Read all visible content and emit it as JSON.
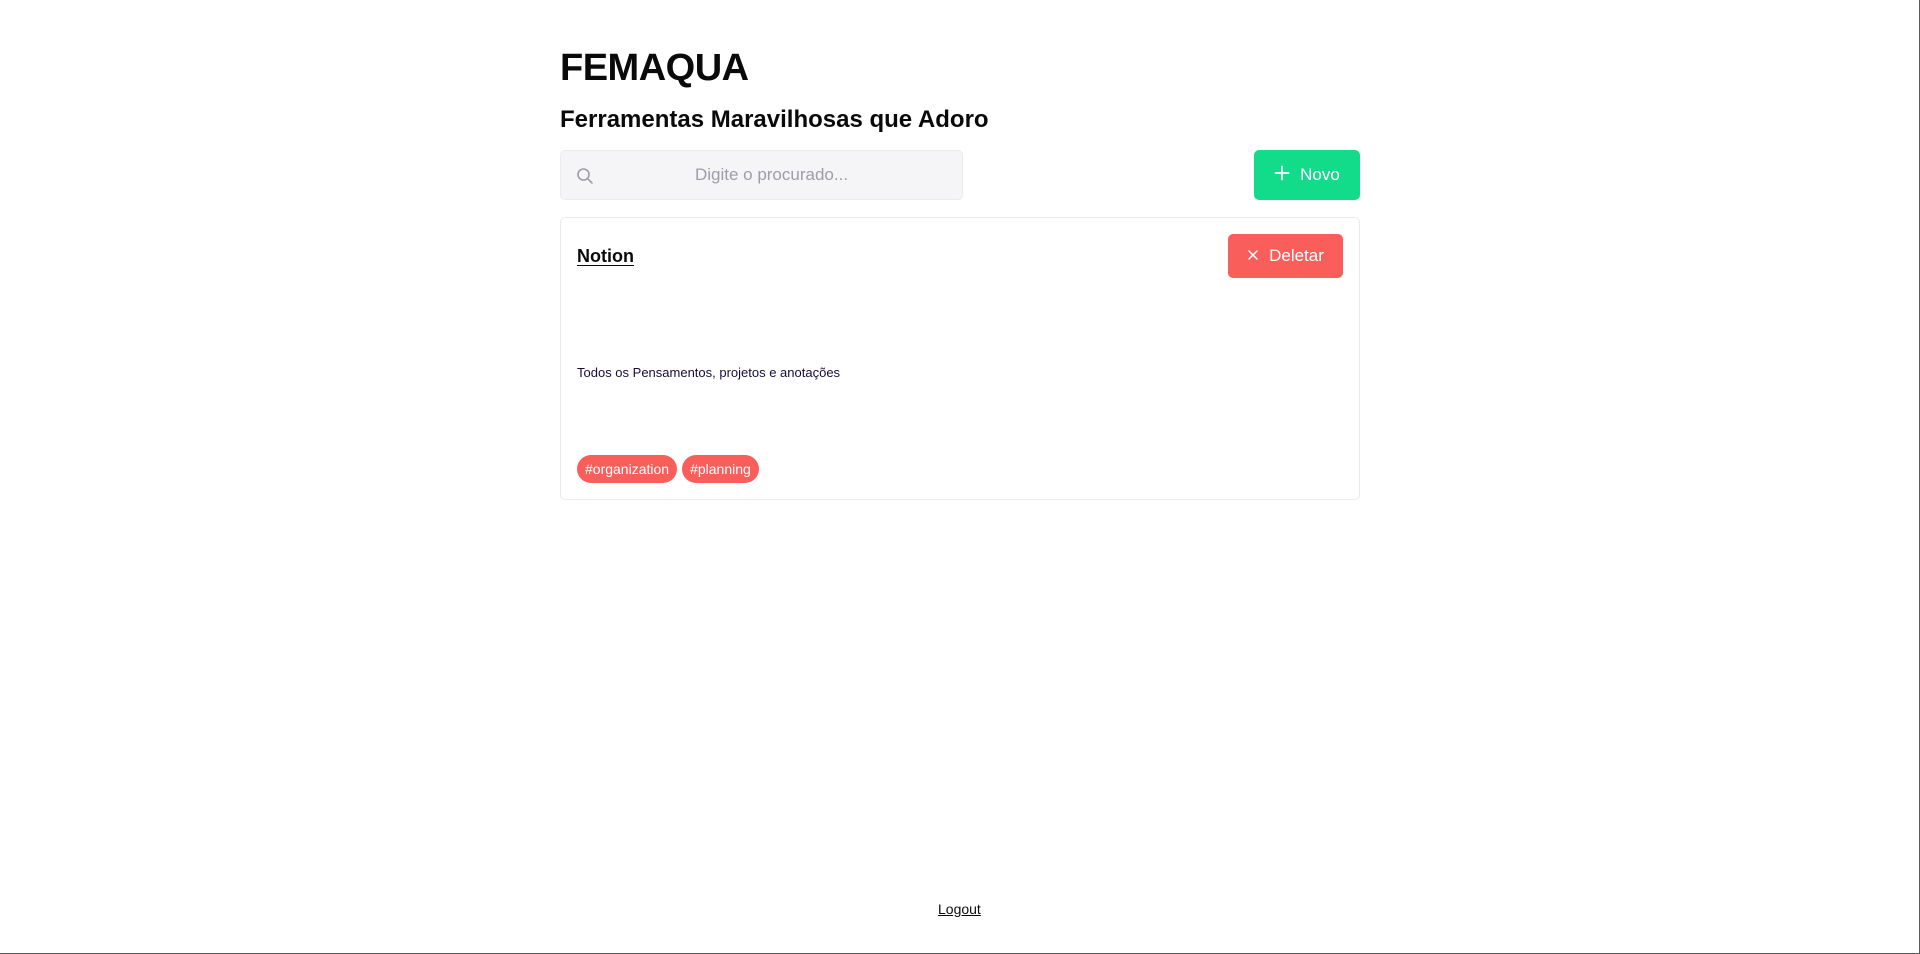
{
  "header": {
    "title": "FEMAQUA",
    "subtitle": "Ferramentas Maravilhosas que Adoro"
  },
  "toolbar": {
    "search": {
      "placeholder": "Digite o procurado...",
      "value": "",
      "icon": "search-icon"
    },
    "new_button": {
      "label": "Novo",
      "icon": "plus-icon"
    }
  },
  "tools": [
    {
      "title": "Notion",
      "description": "Todos os Pensamentos, projetos e anotações",
      "delete_label": "Deletar",
      "delete_icon": "close-icon",
      "tags": [
        "#organization",
        "#planning"
      ]
    }
  ],
  "footer": {
    "logout_label": "Logout"
  },
  "colors": {
    "primary_green": "#12db89",
    "danger_red": "#f95e5a",
    "input_bg": "#f5f4f6",
    "border": "#ebeaed",
    "text_dark": "#170c3a"
  }
}
